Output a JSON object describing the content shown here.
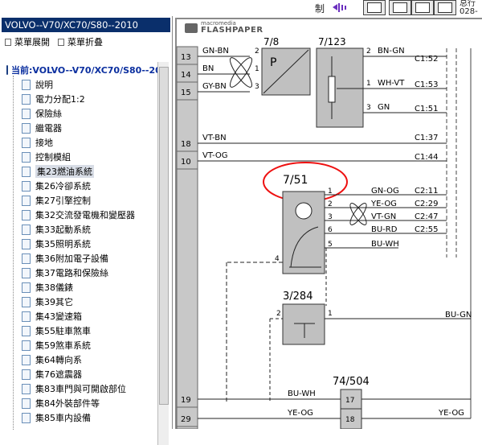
{
  "top": {
    "menu_char": "制",
    "corner_line1": "总行",
    "corner_line2": "028-8",
    "nav_buttons": [
      "first-page",
      "prev-page",
      "next-page",
      "last-page"
    ]
  },
  "left": {
    "title": "VOLVO--V70/XC70/S80--2010",
    "toolbar": {
      "expand": "菜單展開",
      "collapse": "菜單折叠"
    },
    "root_label": "当前:VOLVO--V70/XC70/S80--2010",
    "items": [
      "說明",
      "電力分配1:2",
      "保險絲",
      "繼電器",
      "接地",
      "控制模組",
      "集23燃油系統",
      "集26冷卻系統",
      "集27引擎控制",
      "集32交流發電機和變壓器",
      "集33起動系統",
      "集35照明系統",
      "集36附加電子設備",
      "集37電路和保險絲",
      "集38儀錶",
      "集39其它",
      "集43變速箱",
      "集55駐車煞車",
      "集59煞車系統",
      "集64轉向系",
      "集76遮震器",
      "集83車門與可開啟部位",
      "集84外裝部件等",
      "集85車内設備"
    ],
    "selected_index": 6
  },
  "viewer": {
    "logo_top": "macromedia",
    "logo_bottom": "FLASHPAPER",
    "left_pins": [
      "13",
      "14",
      "15",
      "18",
      "10",
      "19",
      "29"
    ],
    "wires_left": [
      {
        "pin": "13",
        "label": "GN-BN"
      },
      {
        "pin": "14",
        "label": "BN"
      },
      {
        "pin": "15",
        "label": "GY-BN"
      },
      {
        "pin": "18",
        "label": "VT-BN"
      },
      {
        "pin": "10",
        "label": "VT-OG"
      }
    ],
    "comp_7_8": "7/8",
    "comp_7_123": "7/123",
    "comp_7_51": "7/51",
    "comp_3_284": "3/284",
    "comp_74_504": "74/504",
    "pump_letter": "P",
    "connector_labels_top": [
      {
        "pin": "2",
        "wire": "BN-GN",
        "conn": "C1:52"
      },
      {
        "pin": "1",
        "wire": "WH-VT",
        "conn": "C1:53"
      },
      {
        "pin": "3",
        "wire": "GN",
        "conn": "C1:51"
      }
    ],
    "mid_conns": [
      {
        "wire": "",
        "conn": "C1:37"
      },
      {
        "wire": "",
        "conn": "C1:44"
      }
    ],
    "sensor_wires": [
      {
        "pin": "1",
        "wire": "GN-OG",
        "conn": "C2:11"
      },
      {
        "pin": "2",
        "wire": "YE-OG",
        "conn": "C2:29"
      },
      {
        "pin": "3",
        "wire": "VT-GN",
        "conn": "C2:47"
      },
      {
        "pin": "6",
        "wire": "BU-RD",
        "conn": "C2:55"
      },
      {
        "pin": "5",
        "wire": "BU-WH",
        "conn": ""
      }
    ],
    "pin4": "4",
    "fan_pins": [
      "2",
      "1"
    ],
    "bu_gn": "BU-GN",
    "bottom_wires": [
      {
        "pin": "19",
        "wire": "BU-WH",
        "conn_pin": "17"
      },
      {
        "pin": "29",
        "wire": "YE-OG",
        "conn_pin": "18",
        "right_wire": "YE-OG"
      }
    ]
  }
}
